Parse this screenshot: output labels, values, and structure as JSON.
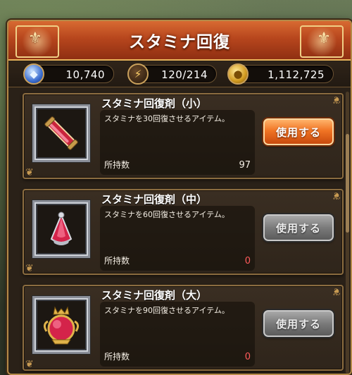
{
  "dialog": {
    "title": "スタミナ回復"
  },
  "resources": {
    "gems": "10,740",
    "stamina": "120/214",
    "gold": "1,112,725"
  },
  "items": [
    {
      "name": "スタミナ回復剤（小）",
      "description": "スタミナを30回復させるアイテム。",
      "owned_label": "所持数",
      "owned": "97",
      "button": "使用する",
      "enabled": true,
      "icon": "small-stamina-vial-icon"
    },
    {
      "name": "スタミナ回復剤（中）",
      "description": "スタミナを60回復させるアイテム。",
      "owned_label": "所持数",
      "owned": "0",
      "button": "使用する",
      "enabled": false,
      "icon": "medium-stamina-potion-icon"
    },
    {
      "name": "スタミナ回復剤（大）",
      "description": "スタミナを90回復させるアイテム。",
      "owned_label": "所持数",
      "owned": "0",
      "button": "使用する",
      "enabled": false,
      "icon": "large-stamina-flask-icon"
    }
  ],
  "colors": {
    "title_bar": "#b7461d",
    "enabled_button": "#f07424",
    "disabled_button": "#7b7b7b",
    "zero_count": "#ff5a5a"
  }
}
